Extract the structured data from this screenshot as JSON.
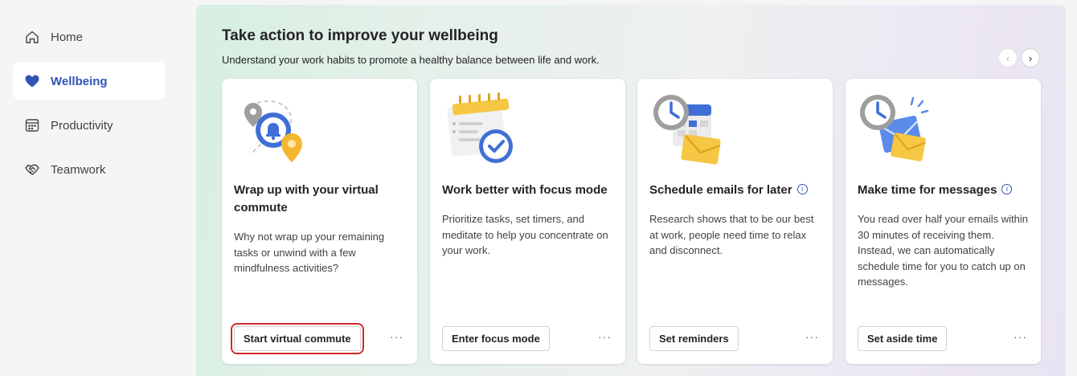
{
  "sidebar": {
    "items": [
      {
        "label": "Home",
        "icon": "home-icon",
        "active": false
      },
      {
        "label": "Wellbeing",
        "icon": "heart-icon",
        "active": true
      },
      {
        "label": "Productivity",
        "icon": "calendar-grid-icon",
        "active": false
      },
      {
        "label": "Teamwork",
        "icon": "handshake-icon",
        "active": false
      }
    ]
  },
  "main": {
    "title": "Take action to improve your wellbeing",
    "subtitle": "Understand your work habits to promote a healthy balance between life and work.",
    "prev_label": "‹",
    "next_label": "›",
    "cards": [
      {
        "title": "Wrap up with your virtual commute",
        "description": "Why not wrap up your remaining tasks or unwind with a few mindfulness activities?",
        "button": "Start virtual commute",
        "more": "···",
        "illustration": "commute-map-pin-bell-icon"
      },
      {
        "title": "Work better with focus mode",
        "description": "Prioritize tasks, set timers, and meditate to help you concentrate on your work.",
        "button": "Enter focus mode",
        "more": "···",
        "illustration": "focus-checklist-icon"
      },
      {
        "title": "Schedule emails for later",
        "description": "Research shows that to be our best at work, people need time to relax and disconnect.",
        "button": "Set reminders",
        "more": "···",
        "illustration": "clock-calendar-envelope-icon"
      },
      {
        "title": "Make time for messages",
        "description": "You read over half your emails within 30 minutes of receiving them. Instead, we can automatically schedule time for you to catch up on messages.",
        "button": "Set aside time",
        "more": "···",
        "illustration": "clock-envelopes-icon"
      }
    ]
  },
  "colors": {
    "accent": "#3255b5",
    "highlight_outline": "#d12a2a"
  }
}
